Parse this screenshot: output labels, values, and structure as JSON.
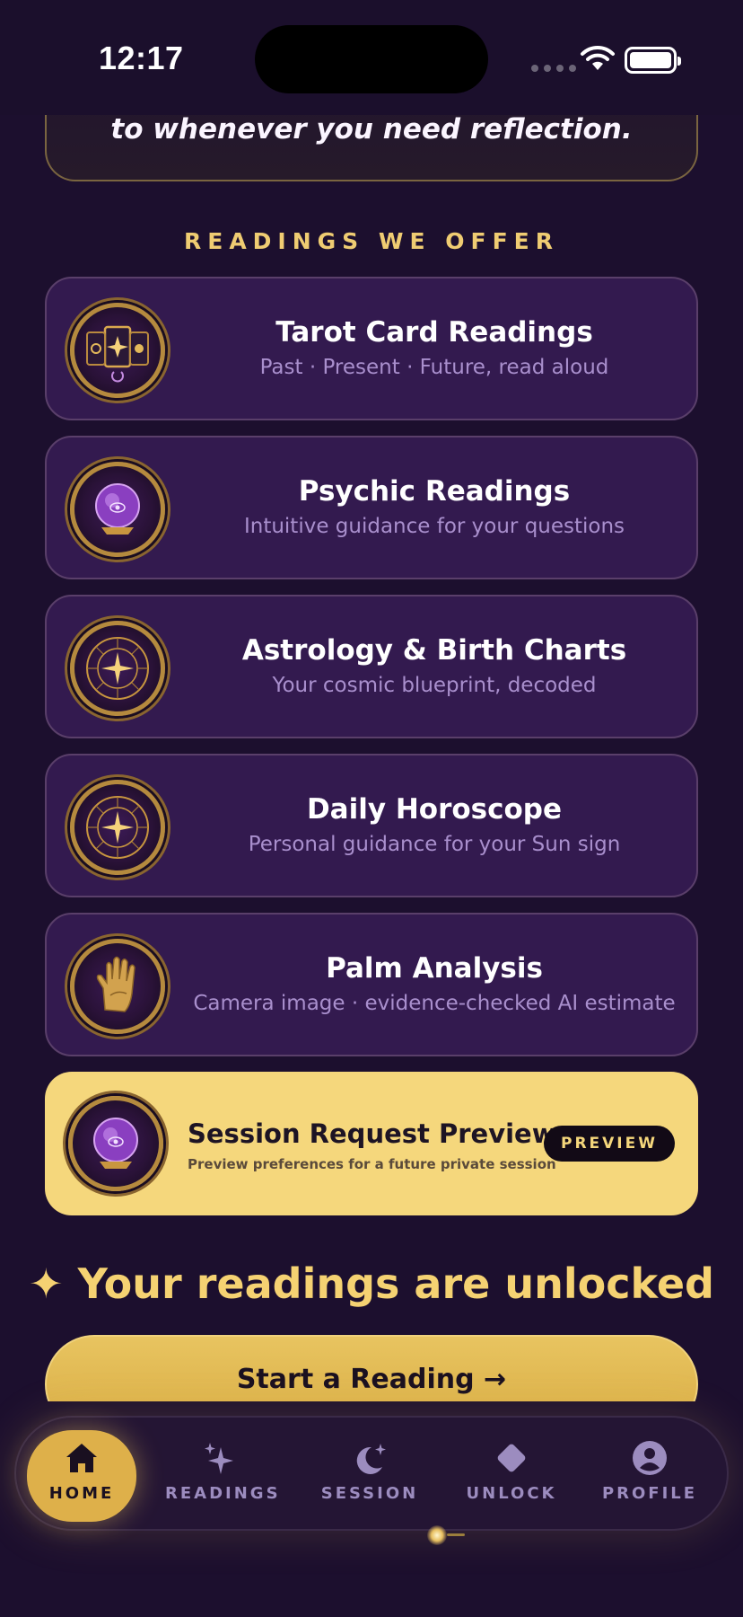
{
  "status_bar": {
    "time": "12:17"
  },
  "quote": {
    "text": "to whenever you need reflection."
  },
  "section": {
    "title": "READINGS WE OFFER"
  },
  "readings": [
    {
      "title": "Tarot Card Readings",
      "subtitle": "Past · Present · Future, read aloud",
      "icon": "tarot-cards-icon"
    },
    {
      "title": "Psychic Readings",
      "subtitle": "Intuitive guidance for your questions",
      "icon": "crystal-ball-icon"
    },
    {
      "title": "Astrology & Birth Charts",
      "subtitle": "Your cosmic blueprint, decoded",
      "icon": "zodiac-wheel-icon"
    },
    {
      "title": "Daily Horoscope",
      "subtitle": "Personal guidance for your Sun sign",
      "icon": "zodiac-wheel-icon"
    },
    {
      "title": "Palm Analysis",
      "subtitle": "Camera image · evidence-checked AI estimate",
      "icon": "palm-hand-icon"
    }
  ],
  "preview": {
    "title": "Session Request Preview",
    "subtitle": "Preview preferences for a future private session",
    "badge": "PREVIEW",
    "icon": "crystal-ball-icon"
  },
  "unlocked": {
    "text": "✦ Your readings are unlocked"
  },
  "cta": {
    "label": "Start a Reading →"
  },
  "tabs": [
    {
      "label": "HOME",
      "icon": "home-icon",
      "active": true
    },
    {
      "label": "READINGS",
      "icon": "sparkle-icon",
      "active": false
    },
    {
      "label": "SESSION",
      "icon": "moon-stars-icon",
      "active": false
    },
    {
      "label": "UNLOCK",
      "icon": "diamond-icon",
      "active": false
    },
    {
      "label": "PROFILE",
      "icon": "profile-icon",
      "active": false
    }
  ],
  "colors": {
    "background": "#1c0f2e",
    "card": "#331a4f",
    "gold": "#f5d77c",
    "accent_text": "#efcc72",
    "muted_text": "#a98fcd"
  }
}
